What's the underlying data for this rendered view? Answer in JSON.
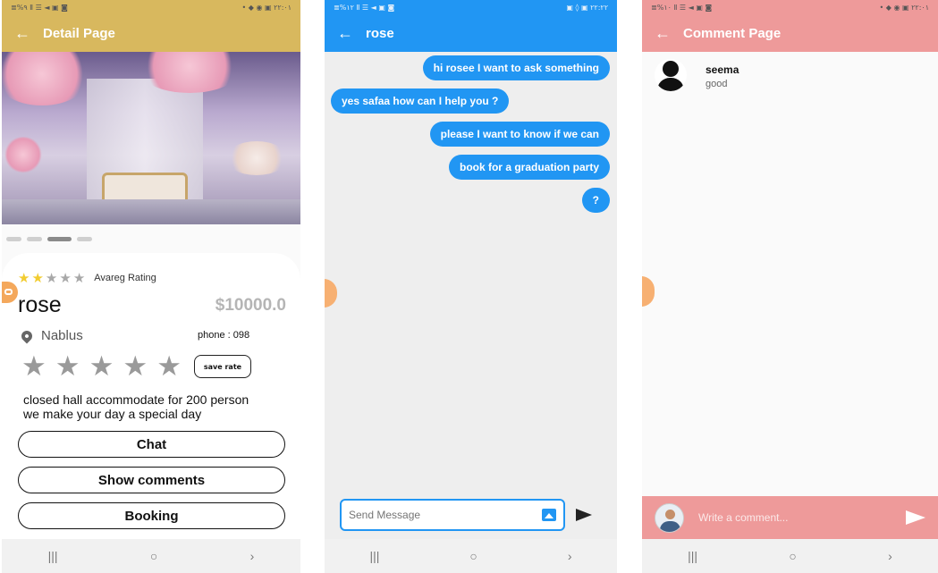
{
  "colors": {
    "detail_accent": "#d8b85e",
    "chat_accent": "#2196f3",
    "comment_accent": "#ee9a9a",
    "star_on": "#f2cc30",
    "star_off": "#a8a8a8"
  },
  "detail": {
    "status_left": "≣%٩ Ⅱ ☰ ◄ ▣ ◙",
    "status_right": "• ◆ ◉ ▣ ٢٢:٠١",
    "title": "Detail Page",
    "carousel_count": 4,
    "carousel_active_index": 2,
    "avg_rating_label": "Avareg Rating",
    "avg_rating_value": 2,
    "avg_rating_max": 5,
    "name": "rose",
    "price": "$10000.0",
    "location": "Nablus",
    "phone": "phone : 098",
    "save_rate_label": "save rate",
    "description_line1": "closed hall accommodate for 200 person",
    "description_line2": "we make your day a special day",
    "chat_label": "Chat",
    "show_comments_label": "Show comments",
    "booking_label": "Booking"
  },
  "chat": {
    "status_left": "≣%١٢ Ⅱ ☰ ◄ ▣ ◙",
    "status_right": "▣ ◊ ▣ ٢٢:٢٢",
    "title": "rose",
    "messages": [
      {
        "text": "hi rosee I want to ask something",
        "side": "right"
      },
      {
        "text": "yes safaa how can I help you ?",
        "side": "left"
      },
      {
        "text": "please I want to know if we can",
        "side": "right"
      },
      {
        "text": "book for a graduation party",
        "side": "right"
      },
      {
        "text": "?",
        "side": "right"
      }
    ],
    "input_placeholder": "Send Message"
  },
  "comments": {
    "status_left": "≣%١٠ Ⅱ ☰ ◄ ▣ ◙",
    "status_right": "• ◆ ◉ ▣ ٢٢:٠١",
    "title": "Comment Page",
    "items": [
      {
        "user": "seema",
        "text": "good"
      }
    ],
    "input_placeholder": "Write a comment..."
  },
  "nav": {
    "recent": "|||",
    "home": "○",
    "back": "›"
  }
}
